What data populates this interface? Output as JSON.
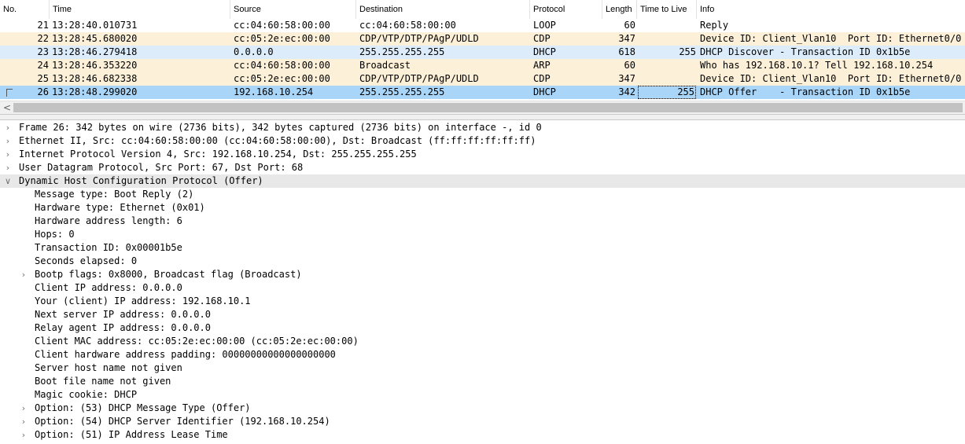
{
  "packet_list": {
    "columns": {
      "no": "No.",
      "time": "Time",
      "source": "Source",
      "destination": "Destination",
      "protocol": "Protocol",
      "length": "Length",
      "ttl": "Time to Live",
      "info": "Info"
    },
    "rows": [
      {
        "no": "21",
        "time": "13:28:40.010731",
        "source": "cc:04:60:58:00:00",
        "destination": "cc:04:60:58:00:00",
        "protocol": "LOOP",
        "length": "60",
        "ttl": "",
        "info": "Reply",
        "bg": "#ffffff"
      },
      {
        "no": "22",
        "time": "13:28:45.680020",
        "source": "cc:05:2e:ec:00:00",
        "destination": "CDP/VTP/DTP/PAgP/UDLD",
        "protocol": "CDP",
        "length": "347",
        "ttl": "",
        "info": "Device ID: Client_Vlan10  Port ID: Ethernet0/0",
        "bg": "#fdf0d8"
      },
      {
        "no": "23",
        "time": "13:28:46.279418",
        "source": "0.0.0.0",
        "destination": "255.255.255.255",
        "protocol": "DHCP",
        "length": "618",
        "ttl": "255",
        "info": "DHCP Discover - Transaction ID 0x1b5e",
        "bg": "#dcecfb"
      },
      {
        "no": "24",
        "time": "13:28:46.353220",
        "source": "cc:04:60:58:00:00",
        "destination": "Broadcast",
        "protocol": "ARP",
        "length": "60",
        "ttl": "",
        "info": "Who has 192.168.10.1? Tell 192.168.10.254",
        "bg": "#fdf0d8"
      },
      {
        "no": "25",
        "time": "13:28:46.682338",
        "source": "cc:05:2e:ec:00:00",
        "destination": "CDP/VTP/DTP/PAgP/UDLD",
        "protocol": "CDP",
        "length": "347",
        "ttl": "",
        "info": "Device ID: Client_Vlan10  Port ID: Ethernet0/0",
        "bg": "#fdf0d8"
      },
      {
        "no": "26",
        "time": "13:28:48.299020",
        "source": "192.168.10.254",
        "destination": "255.255.255.255",
        "protocol": "DHCP",
        "length": "342",
        "ttl": "255",
        "info": "DHCP Offer    - Transaction ID 0x1b5e",
        "bg": "#a9d6f8",
        "selected": true
      }
    ],
    "scroll_left_glyph": "<"
  },
  "details": {
    "lines": [
      {
        "indent": 0,
        "arrow": "right",
        "text": "Frame 26: 342 bytes on wire (2736 bits), 342 bytes captured (2736 bits) on interface -, id 0"
      },
      {
        "indent": 0,
        "arrow": "right",
        "text": "Ethernet II, Src: cc:04:60:58:00:00 (cc:04:60:58:00:00), Dst: Broadcast (ff:ff:ff:ff:ff:ff)"
      },
      {
        "indent": 0,
        "arrow": "right",
        "text": "Internet Protocol Version 4, Src: 192.168.10.254, Dst: 255.255.255.255"
      },
      {
        "indent": 0,
        "arrow": "right",
        "text": "User Datagram Protocol, Src Port: 67, Dst Port: 68"
      },
      {
        "indent": 0,
        "arrow": "down",
        "text": "Dynamic Host Configuration Protocol (Offer)",
        "highlight": true
      },
      {
        "indent": 1,
        "arrow": "",
        "text": "Message type: Boot Reply (2)"
      },
      {
        "indent": 1,
        "arrow": "",
        "text": "Hardware type: Ethernet (0x01)"
      },
      {
        "indent": 1,
        "arrow": "",
        "text": "Hardware address length: 6"
      },
      {
        "indent": 1,
        "arrow": "",
        "text": "Hops: 0"
      },
      {
        "indent": 1,
        "arrow": "",
        "text": "Transaction ID: 0x00001b5e"
      },
      {
        "indent": 1,
        "arrow": "",
        "text": "Seconds elapsed: 0"
      },
      {
        "indent": 1,
        "arrow": "right",
        "text": "Bootp flags: 0x8000, Broadcast flag (Broadcast)"
      },
      {
        "indent": 1,
        "arrow": "",
        "text": "Client IP address: 0.0.0.0"
      },
      {
        "indent": 1,
        "arrow": "",
        "text": "Your (client) IP address: 192.168.10.1"
      },
      {
        "indent": 1,
        "arrow": "",
        "text": "Next server IP address: 0.0.0.0"
      },
      {
        "indent": 1,
        "arrow": "",
        "text": "Relay agent IP address: 0.0.0.0"
      },
      {
        "indent": 1,
        "arrow": "",
        "text": "Client MAC address: cc:05:2e:ec:00:00 (cc:05:2e:ec:00:00)"
      },
      {
        "indent": 1,
        "arrow": "",
        "text": "Client hardware address padding: 00000000000000000000"
      },
      {
        "indent": 1,
        "arrow": "",
        "text": "Server host name not given"
      },
      {
        "indent": 1,
        "arrow": "",
        "text": "Boot file name not given"
      },
      {
        "indent": 1,
        "arrow": "",
        "text": "Magic cookie: DHCP"
      },
      {
        "indent": 1,
        "arrow": "right",
        "text": "Option: (53) DHCP Message Type (Offer)"
      },
      {
        "indent": 1,
        "arrow": "right",
        "text": "Option: (54) DHCP Server Identifier (192.168.10.254)"
      },
      {
        "indent": 1,
        "arrow": "right",
        "text": "Option: (51) IP Address Lease Time"
      }
    ]
  },
  "icons": {
    "expand": "chevron-right-icon",
    "collapse": "chevron-down-icon",
    "scroll_left": "arrow-left-icon"
  }
}
